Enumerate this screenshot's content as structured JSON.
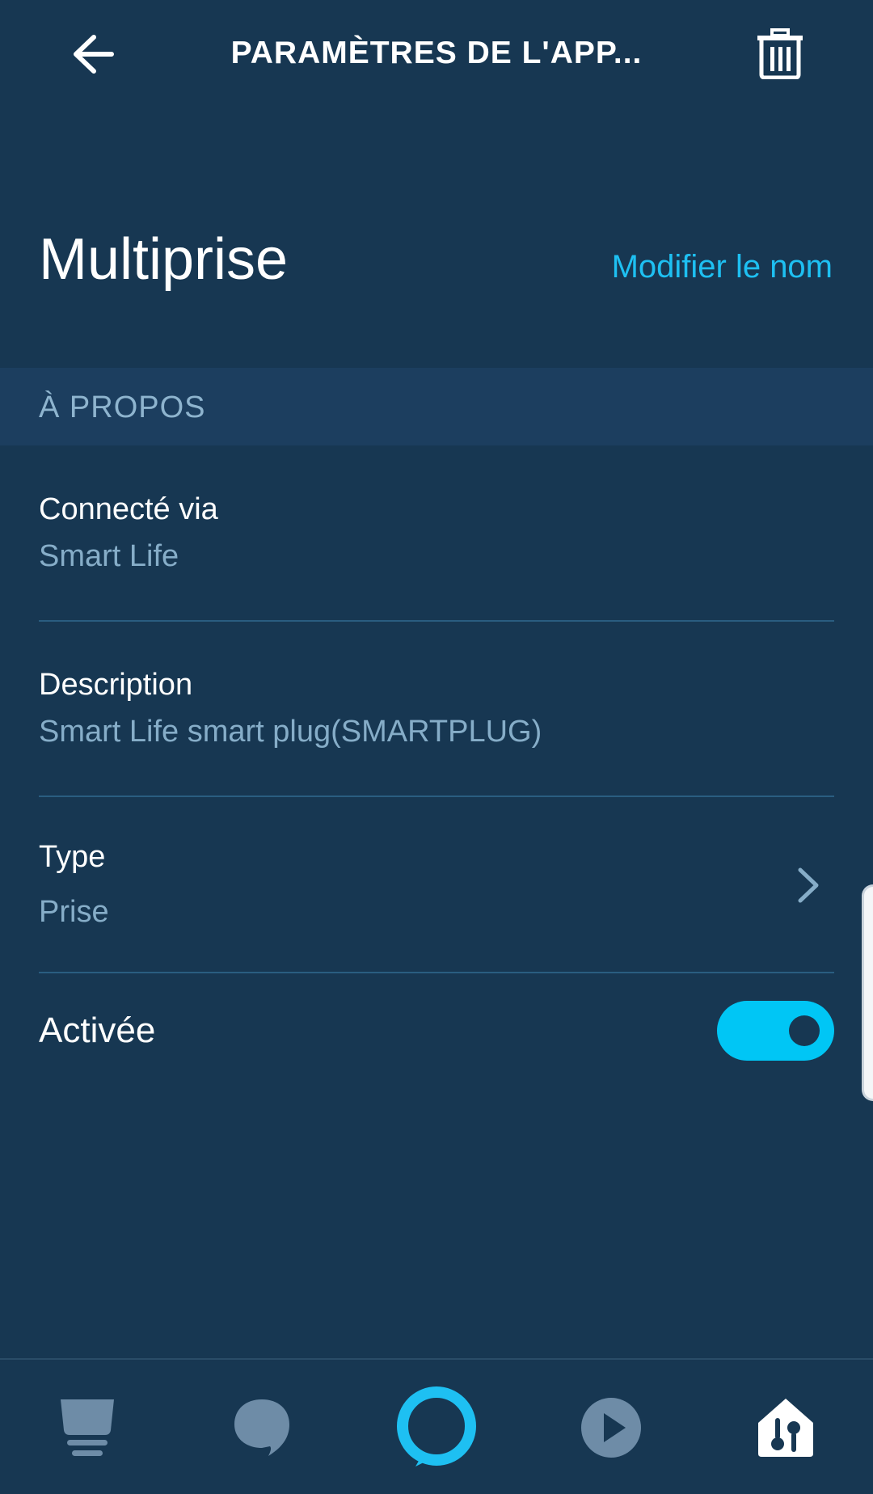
{
  "header": {
    "title": "PARAMÈTRES DE L'APP...",
    "back_icon": "arrow-left-icon",
    "delete_icon": "trash-icon"
  },
  "device": {
    "name": "Multiprise",
    "rename_label": "Modifier le nom"
  },
  "about_section": {
    "title": "À PROPOS",
    "rows": [
      {
        "label": "Connecté via",
        "value": "Smart Life"
      },
      {
        "label": "Description",
        "value": "Smart Life smart plug(SMARTPLUG)"
      },
      {
        "label": "Type",
        "value": "Prise"
      }
    ]
  },
  "enabled": {
    "label": "Activée",
    "on": true
  },
  "bottom_nav": {
    "items": [
      {
        "icon": "home-dashboard-icon",
        "active": false
      },
      {
        "icon": "chat-bubble-icon",
        "active": false
      },
      {
        "icon": "alexa-ring-icon",
        "active": false
      },
      {
        "icon": "play-icon",
        "active": false
      },
      {
        "icon": "smart-home-devices-icon",
        "active": true
      }
    ]
  },
  "colors": {
    "background": "#173752",
    "accent": "#1ec0f2",
    "toggle_on": "#00c6f5",
    "secondary_text": "#86adc8"
  }
}
